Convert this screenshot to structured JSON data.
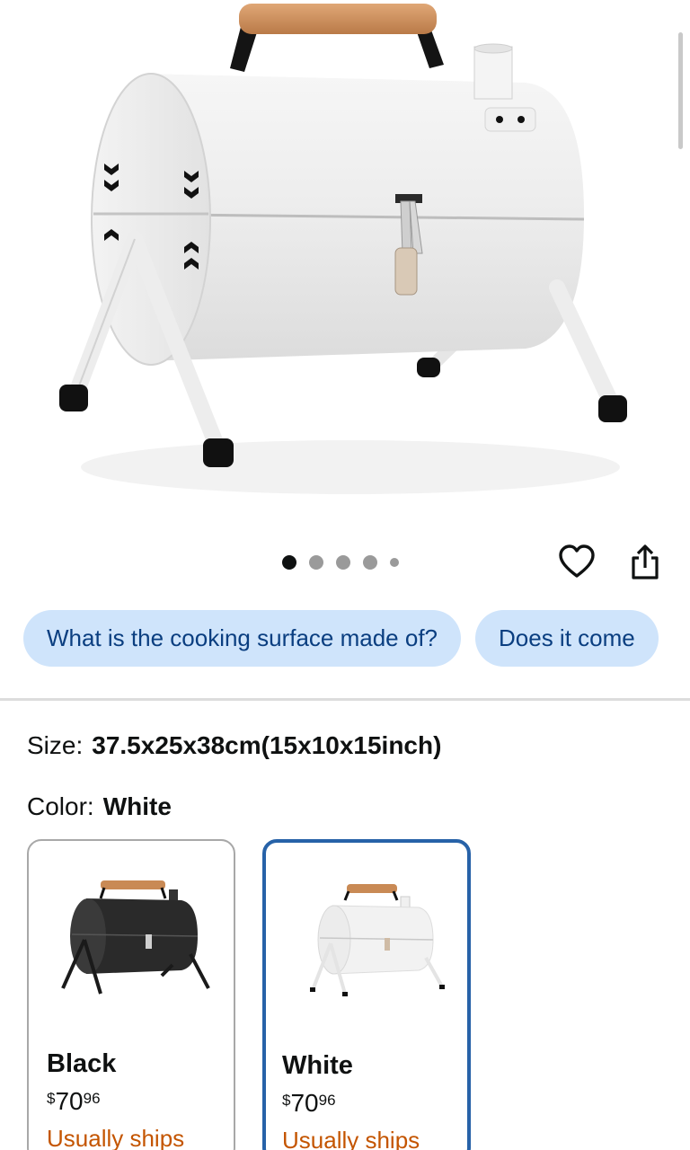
{
  "product_image": {
    "alt": "white-portable-barrel-grill"
  },
  "carousel": {
    "total": 5,
    "active_index": 0
  },
  "actions": {
    "wishlist_icon": "heart-icon",
    "share_icon": "share-icon"
  },
  "questions": {
    "chips": [
      {
        "label": "What is the cooking surface made of?"
      },
      {
        "label": "Does it come"
      }
    ]
  },
  "variants": {
    "size_label": "Size:",
    "size_value": "37.5x25x38cm(15x10x15inch)",
    "color_label": "Color:",
    "color_value": "White",
    "options": [
      {
        "name": "Black",
        "price_symbol": "$",
        "price_whole": "70",
        "price_cents": "96",
        "ships": "Usually ships",
        "selected": false
      },
      {
        "name": "White",
        "price_symbol": "$",
        "price_whole": "70",
        "price_cents": "96",
        "ships": "Usually ships",
        "selected": true
      }
    ]
  },
  "colors": {
    "chip_bg": "#cfe4fb",
    "chip_text": "#0a3e80",
    "selected_border": "#2762a8",
    "ships_text": "#c45500"
  }
}
